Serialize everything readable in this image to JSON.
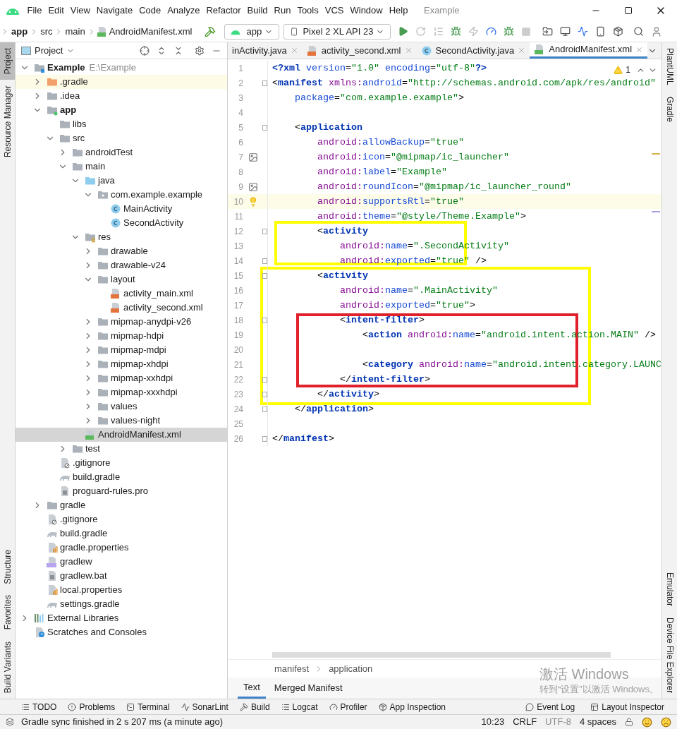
{
  "menu": {
    "items": [
      "File",
      "Edit",
      "View",
      "Navigate",
      "Code",
      "Analyze",
      "Refactor",
      "Build",
      "Run",
      "Tools",
      "VCS",
      "Window",
      "Help"
    ],
    "title": "Example"
  },
  "nav": {
    "breadcrumb": [
      "app",
      "src",
      "main",
      "AndroidManifest.xml"
    ],
    "config": "app",
    "device": "Pixel 2 XL API 23"
  },
  "left_strip": {
    "top": [
      {
        "label": "Project",
        "selected": true
      },
      {
        "label": "Resource Manager",
        "selected": false
      }
    ],
    "bottom": [
      {
        "label": "Structure",
        "selected": false
      },
      {
        "label": "Favorites",
        "selected": false
      },
      {
        "label": "Build Variants",
        "selected": false
      }
    ]
  },
  "right_strip": {
    "top": [
      "PlantUML",
      "Gradle"
    ],
    "bottom": [
      "Emulator",
      "Device File Explorer"
    ]
  },
  "project_panel": {
    "title": "Project",
    "tree": [
      {
        "label": "Example",
        "suffix": "E:\\Example",
        "kind": "project",
        "bold": true,
        "expanded": true,
        "selected": false,
        "children": [
          {
            "label": ".gradle",
            "kind": "folder_orange",
            "expanded": false,
            "selected": false,
            "highlighted": true
          },
          {
            "label": ".idea",
            "kind": "folder",
            "expanded": false,
            "selected": false
          },
          {
            "label": "app",
            "kind": "module",
            "bold": true,
            "expanded": true,
            "selected": false,
            "children": [
              {
                "label": "libs",
                "kind": "folder",
                "selected": false
              },
              {
                "label": "src",
                "kind": "folder",
                "expanded": true,
                "selected": false,
                "children": [
                  {
                    "label": "androidTest",
                    "kind": "folder",
                    "expanded": false,
                    "selected": false
                  },
                  {
                    "label": "main",
                    "kind": "folder",
                    "expanded": true,
                    "selected": false,
                    "children": [
                      {
                        "label": "java",
                        "kind": "source",
                        "expanded": true,
                        "selected": false,
                        "children": [
                          {
                            "label": "com.example.example",
                            "kind": "package",
                            "expanded": true,
                            "selected": false,
                            "children": [
                              {
                                "label": "MainActivity",
                                "kind": "class",
                                "selected": false
                              },
                              {
                                "label": "SecondActivity",
                                "kind": "class",
                                "selected": false
                              }
                            ]
                          }
                        ]
                      },
                      {
                        "label": "res",
                        "kind": "res",
                        "expanded": true,
                        "selected": false,
                        "children": [
                          {
                            "label": "drawable",
                            "kind": "folder",
                            "expanded": false,
                            "selected": false
                          },
                          {
                            "label": "drawable-v24",
                            "kind": "folder",
                            "expanded": false,
                            "selected": false
                          },
                          {
                            "label": "layout",
                            "kind": "folder",
                            "expanded": true,
                            "selected": false,
                            "children": [
                              {
                                "label": "activity_main.xml",
                                "kind": "layout_xml",
                                "selected": false
                              },
                              {
                                "label": "activity_second.xml",
                                "kind": "layout_xml",
                                "selected": false
                              }
                            ]
                          },
                          {
                            "label": "mipmap-anydpi-v26",
                            "kind": "folder",
                            "expanded": false,
                            "selected": false
                          },
                          {
                            "label": "mipmap-hdpi",
                            "kind": "folder",
                            "expanded": false,
                            "selected": false
                          },
                          {
                            "label": "mipmap-mdpi",
                            "kind": "folder",
                            "expanded": false,
                            "selected": false
                          },
                          {
                            "label": "mipmap-xhdpi",
                            "kind": "folder",
                            "expanded": false,
                            "selected": false
                          },
                          {
                            "label": "mipmap-xxhdpi",
                            "kind": "folder",
                            "expanded": false,
                            "selected": false
                          },
                          {
                            "label": "mipmap-xxxhdpi",
                            "kind": "folder",
                            "expanded": false,
                            "selected": false
                          },
                          {
                            "label": "values",
                            "kind": "folder",
                            "expanded": false,
                            "selected": false
                          },
                          {
                            "label": "values-night",
                            "kind": "folder",
                            "expanded": false,
                            "selected": false
                          }
                        ]
                      },
                      {
                        "label": "AndroidManifest.xml",
                        "kind": "manifest",
                        "selected": true
                      }
                    ]
                  },
                  {
                    "label": "test",
                    "kind": "folder",
                    "expanded": false,
                    "selected": false
                  }
                ]
              },
              {
                "label": ".gitignore",
                "kind": "gitignore",
                "selected": false
              },
              {
                "label": "build.gradle",
                "kind": "gradle",
                "selected": false
              },
              {
                "label": "proguard-rules.pro",
                "kind": "text",
                "selected": false
              }
            ]
          },
          {
            "label": "gradle",
            "kind": "folder",
            "expanded": false,
            "selected": false
          },
          {
            "label": ".gitignore",
            "kind": "gitignore",
            "selected": false
          },
          {
            "label": "build.gradle",
            "kind": "gradle",
            "selected": false
          },
          {
            "label": "gradle.properties",
            "kind": "properties",
            "selected": false
          },
          {
            "label": "gradlew",
            "kind": "cpp",
            "selected": false
          },
          {
            "label": "gradlew.bat",
            "kind": "text",
            "selected": false
          },
          {
            "label": "local.properties",
            "kind": "properties",
            "selected": false
          },
          {
            "label": "settings.gradle",
            "kind": "gradle",
            "selected": false
          }
        ]
      },
      {
        "label": "External Libraries",
        "kind": "libraries",
        "expanded": false,
        "selected": false
      },
      {
        "label": "Scratches and Consoles",
        "kind": "scratches",
        "selected": false
      }
    ]
  },
  "editor": {
    "tabs": [
      {
        "label": "inActivity.java",
        "selected": false
      },
      {
        "label": "activity_second.xml",
        "kind": "layout_xml",
        "selected": false
      },
      {
        "label": "SecondActivity.java",
        "kind": "class",
        "selected": false
      },
      {
        "label": "AndroidManifest.xml",
        "kind": "manifest",
        "selected": true
      }
    ],
    "warnings": "1",
    "code": [
      {
        "n": "1",
        "text": "<?xml version=\"1.0\" encoding=\"utf-8\"?>"
      },
      {
        "n": "2",
        "fold": true,
        "text": "<manifest xmlns:android=\"http://schemas.android.com/apk/res/android\""
      },
      {
        "n": "3",
        "text": "    package=\"com.example.example\">"
      },
      {
        "n": "4"
      },
      {
        "n": "5",
        "fold": true,
        "text": "    <application"
      },
      {
        "n": "6",
        "text": "        android:allowBackup=\"true\""
      },
      {
        "n": "7",
        "kind": "image",
        "text": "        android:icon=\"@mipmap/ic_launcher\""
      },
      {
        "n": "8",
        "text": "        android:label=\"Example\""
      },
      {
        "n": "9",
        "kind": "image",
        "text": "        android:roundIcon=\"@mipmap/ic_launcher_round\""
      },
      {
        "n": "10",
        "current": true,
        "kind": "bulb",
        "text": "        android:supportsRtl=\"true\""
      },
      {
        "n": "11",
        "text": "        android:theme=\"@style/Theme.Example\">"
      },
      {
        "n": "12",
        "fold": true,
        "text": "        <activity"
      },
      {
        "n": "13",
        "text": "            android:name=\".SecondActivity\""
      },
      {
        "n": "14",
        "fold": true,
        "text": "            android:exported=\"true\" />"
      },
      {
        "n": "15",
        "fold": true,
        "text": "        <activity"
      },
      {
        "n": "16",
        "text": "            android:name=\".MainActivity\""
      },
      {
        "n": "17",
        "text": "            android:exported=\"true\">"
      },
      {
        "n": "18",
        "fold": true,
        "text": "            <intent-filter>"
      },
      {
        "n": "19",
        "text": "                <action android:name=\"android.intent.action.MAIN\" />"
      },
      {
        "n": "20"
      },
      {
        "n": "21",
        "text": "                <category android:name=\"android.intent.category.LAUNC"
      },
      {
        "n": "22",
        "fold": true,
        "text": "            </intent-filter>"
      },
      {
        "n": "23",
        "fold": true,
        "text": "        </activity>"
      },
      {
        "n": "24",
        "fold": true,
        "text": "    </application>"
      },
      {
        "n": "25"
      },
      {
        "n": "26",
        "fold": true,
        "text": "</manifest>"
      }
    ],
    "annotations": [
      {
        "color": "#ffff00"
      },
      {
        "color": "#ffff00"
      },
      {
        "color": "#e0202a"
      }
    ],
    "breadcrumb": [
      "manifest",
      "application"
    ],
    "bottom_tabs": [
      {
        "label": "Text",
        "selected": true
      },
      {
        "label": "Merged Manifest",
        "selected": false
      }
    ]
  },
  "activation": {
    "title": "激活 Windows",
    "subtitle": "转到“设置”以激活 Windows。"
  },
  "tool_windows": {
    "left": [
      "TODO",
      "Problems",
      "Terminal",
      "SonarLint",
      "Build",
      "Logcat",
      "Profiler",
      "App Inspection"
    ],
    "right": [
      "Event Log",
      "Layout Inspector"
    ]
  },
  "status": {
    "message": "Gradle sync finished in 2 s 207 ms (a minute ago)",
    "items": [
      "10:23",
      "CRLF",
      "UTF-8",
      "4 spaces"
    ]
  }
}
